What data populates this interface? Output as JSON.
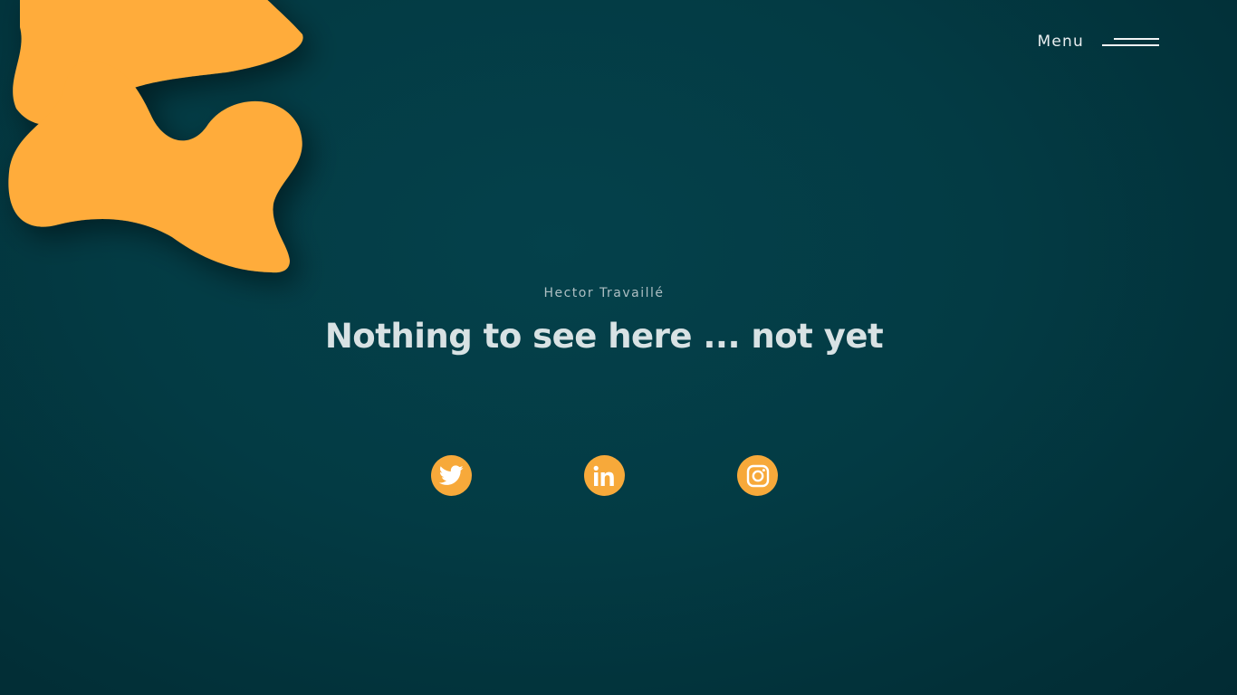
{
  "header": {
    "menu_label": "Menu"
  },
  "hero": {
    "eyebrow": "Hector Travaillé",
    "headline": "Nothing to see here ... not yet"
  },
  "social_links": [
    {
      "name": "twitter",
      "icon": "twitter-icon"
    },
    {
      "name": "linkedin",
      "icon": "linkedin-icon"
    },
    {
      "name": "instagram",
      "icon": "instagram-icon"
    }
  ],
  "colors": {
    "background": "#033b44",
    "accent": "#f7a93a",
    "blob": "#ffac3a",
    "text_primary": "#d8e2e4",
    "text_secondary": "#aebfc3"
  }
}
